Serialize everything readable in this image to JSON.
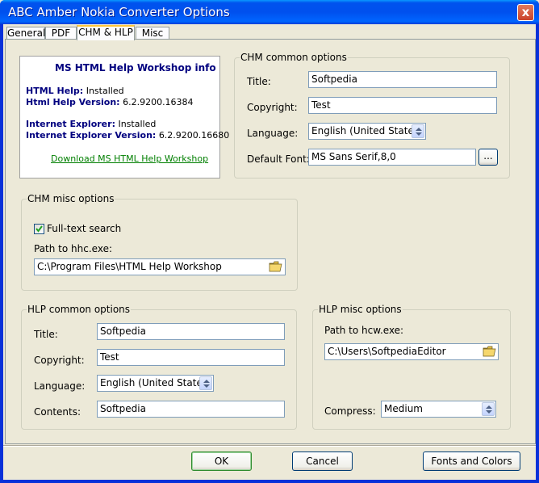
{
  "window": {
    "title": "ABC Amber Nokia Converter Options",
    "close_label": "x"
  },
  "tabs": [
    {
      "label": "General"
    },
    {
      "label": "PDF"
    },
    {
      "label": "CHM & HLP"
    },
    {
      "label": "Misc"
    }
  ],
  "info": {
    "title": "MS HTML Help Workshop info",
    "html_help_key": "HTML Help:",
    "html_help_value": "Installed",
    "html_help_version_key": "Html Help Version:",
    "html_help_version_value": "6.2.9200.16384",
    "ie_key": "Internet Explorer:",
    "ie_value": "Installed",
    "ie_version_key": "Internet Explorer Version:",
    "ie_version_value": "6.2.9200.16680",
    "download_link": "Download MS HTML Help Workshop"
  },
  "chm_common": {
    "legend": "CHM common options",
    "title_label": "Title:",
    "title_value": "Softpedia",
    "copyright_label": "Copyright:",
    "copyright_value": "Test",
    "language_label": "Language:",
    "language_value": "English (United States)",
    "font_label": "Default Font:",
    "font_value": "MS Sans Serif,8,0",
    "font_button": "..."
  },
  "chm_misc": {
    "legend": "CHM misc options",
    "fulltext_label": "Full-text search",
    "fulltext_checked": true,
    "path_label": "Path to hhc.exe:",
    "path_value": "C:\\Program Files\\HTML Help Workshop"
  },
  "hlp_common": {
    "legend": "HLP common options",
    "title_label": "Title:",
    "title_value": "Softpedia",
    "copyright_label": "Copyright:",
    "copyright_value": "Test",
    "language_label": "Language:",
    "language_value": "English (United States)",
    "contents_label": "Contents:",
    "contents_value": "Softpedia"
  },
  "hlp_misc": {
    "legend": "HLP misc options",
    "path_label": "Path to hcw.exe:",
    "path_value": "C:\\Users\\SoftpediaEditor",
    "compress_label": "Compress:",
    "compress_value": "Medium"
  },
  "footer": {
    "ok_label": "OK",
    "cancel_label": "Cancel",
    "fonts_label": "Fonts and Colors"
  }
}
